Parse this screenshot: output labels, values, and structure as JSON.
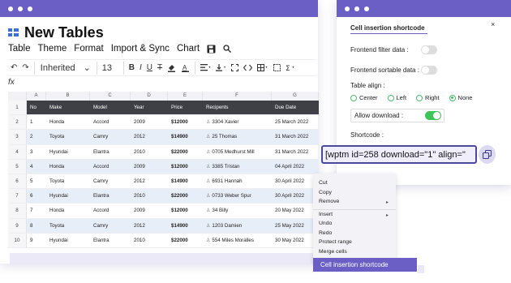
{
  "main_window": {
    "title": "New Tables",
    "menu": [
      "Table",
      "Theme",
      "Format",
      "Import & Sync",
      "Chart"
    ],
    "toolbar": {
      "undo": "↶",
      "redo": "↷",
      "font": "Inherited",
      "font_size": "13",
      "bold": "B",
      "italic": "I",
      "underline": "U",
      "strike": "T"
    },
    "formula_icon": "fx",
    "columns": [
      "A",
      "B",
      "C",
      "D",
      "E",
      "F",
      "G"
    ],
    "header_row": [
      "No",
      "Make",
      "Model",
      "Year",
      "Price",
      "Recipents",
      "Due Date"
    ],
    "rows": [
      [
        "1",
        "Honda",
        "Accord",
        "2009",
        "$12000",
        "3304 Xavier",
        "25 March 2022"
      ],
      [
        "2",
        "Toyota",
        "Camry",
        "2012",
        "$14900",
        "25 Thomas",
        "31 March 2022"
      ],
      [
        "3",
        "Hyundai",
        "Elantra",
        "2010",
        "$22000",
        "0705 Medhurst Mill",
        "31 March 2022"
      ],
      [
        "4",
        "Honda",
        "Accord",
        "2009",
        "$12000",
        "3385 Tristan",
        "04 April 2022"
      ],
      [
        "5",
        "Toyota",
        "Camry",
        "2012",
        "$14900",
        "6931 Hannah",
        "30 April 2022"
      ],
      [
        "6",
        "Hyundai",
        "Elantra",
        "2010",
        "$22000",
        "0733 Weber Spur",
        "30 April 2022"
      ],
      [
        "7",
        "Honda",
        "Accord",
        "2009",
        "$12000",
        "34 Billy",
        "20 May 2022"
      ],
      [
        "8",
        "Toyota",
        "Camry",
        "2012",
        "$14900",
        "1203 Damien",
        "25 May 2022"
      ],
      [
        "9",
        "Hyundai",
        "Elantra",
        "2010",
        "$22000",
        "554 Miles Moralles",
        "30 May 2022"
      ]
    ],
    "row_numbers": [
      "1",
      "2",
      "3",
      "4",
      "5",
      "6",
      "7",
      "8",
      "9",
      "10"
    ]
  },
  "settings": {
    "title": "Cell insertion shortcode",
    "close": "×",
    "frontend_filter": "Frontend filter data :",
    "frontend_sortable": "Frontend sortable data :",
    "table_align": "Table align :",
    "align_options": [
      "Center",
      "Left",
      "Right",
      "None"
    ],
    "align_selected": "None",
    "allow_download": "Allow download :",
    "shortcode_label": "Shortcode :",
    "shortcode_value": "[wptm id=258 download=\"1\" align=\""
  },
  "context_menu": {
    "items": [
      "Cut",
      "Copy",
      "Remove",
      "Insert",
      "Undo",
      "Redo",
      "Protect range",
      "Merge cells"
    ],
    "selected": "Cell insertion shortcode"
  },
  "colors": {
    "accent": "#6b5fc6",
    "header_bg": "#3f3f46",
    "alt_row": "#e8eef8",
    "toggle_on": "#3ec25a"
  }
}
